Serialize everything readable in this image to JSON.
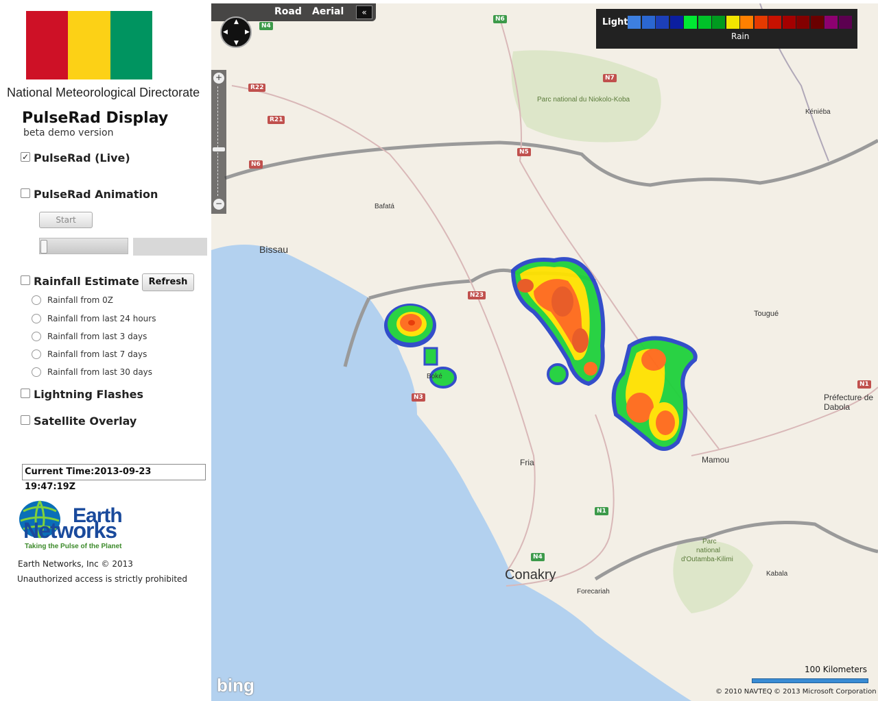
{
  "sidebar": {
    "flag_colors": [
      "#CE1126",
      "#FCD116",
      "#009460"
    ],
    "org_name": "National Meteorological Directorate",
    "app_title": "PulseRad Display",
    "app_subtitle": "beta demo version",
    "options": {
      "live": {
        "label": "PulseRad (Live)",
        "checked": true,
        "check_glyph": "✓"
      },
      "animation": {
        "label": "PulseRad Animation",
        "checked": false
      },
      "start_button": "Start",
      "rainfall": {
        "label": "Rainfall Estimate",
        "checked": false
      },
      "refresh_button": "Refresh",
      "rainfall_periods": [
        "Rainfall from 0Z",
        "Rainfall from last 24 hours",
        "Rainfall from last 3 days",
        "Rainfall from last 7 days",
        "Rainfall from last 30 days"
      ],
      "lightning": {
        "label": "Lightning Flashes",
        "checked": false
      },
      "satellite": {
        "label": "Satellite Overlay",
        "checked": false
      }
    },
    "current_time": "Current Time:2013-09-23 19:47:19Z",
    "logo": {
      "line1": "Earth",
      "line2": "Networks",
      "tagline": "Taking the Pulse of the Planet"
    },
    "copyright": "Earth Networks, Inc © 2013",
    "unauthorized": "Unauthorized access is strictly prohibited"
  },
  "map": {
    "toolbar": {
      "road": "Road",
      "aerial": "Aerial",
      "collapse": "«"
    },
    "legend": {
      "light": "Light",
      "rain": "Rain",
      "colors": [
        "#3d7fe0",
        "#2b67d1",
        "#1c3fb8",
        "#0b1ea0",
        "#00e833",
        "#00c229",
        "#009a1f",
        "#f1e500",
        "#ff8000",
        "#e53a00",
        "#c81100",
        "#a40000",
        "#830000",
        "#690000",
        "#8d0070",
        "#5c0050"
      ]
    },
    "places": {
      "bissau": "Bissau",
      "bafata": "Bafatá",
      "niokolo": "Parc national du Niokolo-Koba",
      "knieba": "Kéniéba",
      "tougue": "Tougué",
      "prefecture": "Préfecture de",
      "dabola": "Dabola",
      "mamou": "Mamou",
      "fria": "Fria",
      "boke": "Boké",
      "conakry": "Conakry",
      "forecariah": "Forecariah",
      "parc1": "Parc",
      "parc2": "national",
      "parc3": "d'Outamba-Kilimi",
      "kabala": "Kabala"
    },
    "roads": [
      "N4",
      "N6",
      "N7",
      "R22",
      "R21",
      "N6",
      "N5",
      "N23",
      "N3",
      "N1",
      "N4",
      "N1"
    ],
    "scale": "100 Kilometers",
    "copyright_navteq": "© 2010 NAVTEQ",
    "copyright_ms": "© 2013 Microsoft Corporation",
    "bing": "bing"
  }
}
